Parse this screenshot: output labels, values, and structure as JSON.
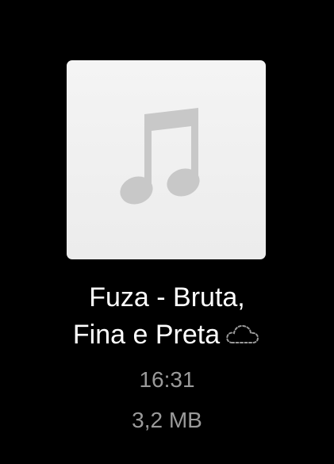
{
  "file": {
    "artwork_icon": "music-note-icon",
    "title_line1": "Fuza - Bruta,",
    "title_line2": "Fina e Preta",
    "cloud_icon": "cloud-download-icon",
    "duration": "16:31",
    "size": "3,2 MB"
  },
  "colors": {
    "background": "#000000",
    "artwork_bg": "#f1f1f1",
    "note_color": "#c8c8c8",
    "title_color": "#ffffff",
    "meta_color": "#9a9a9a"
  }
}
